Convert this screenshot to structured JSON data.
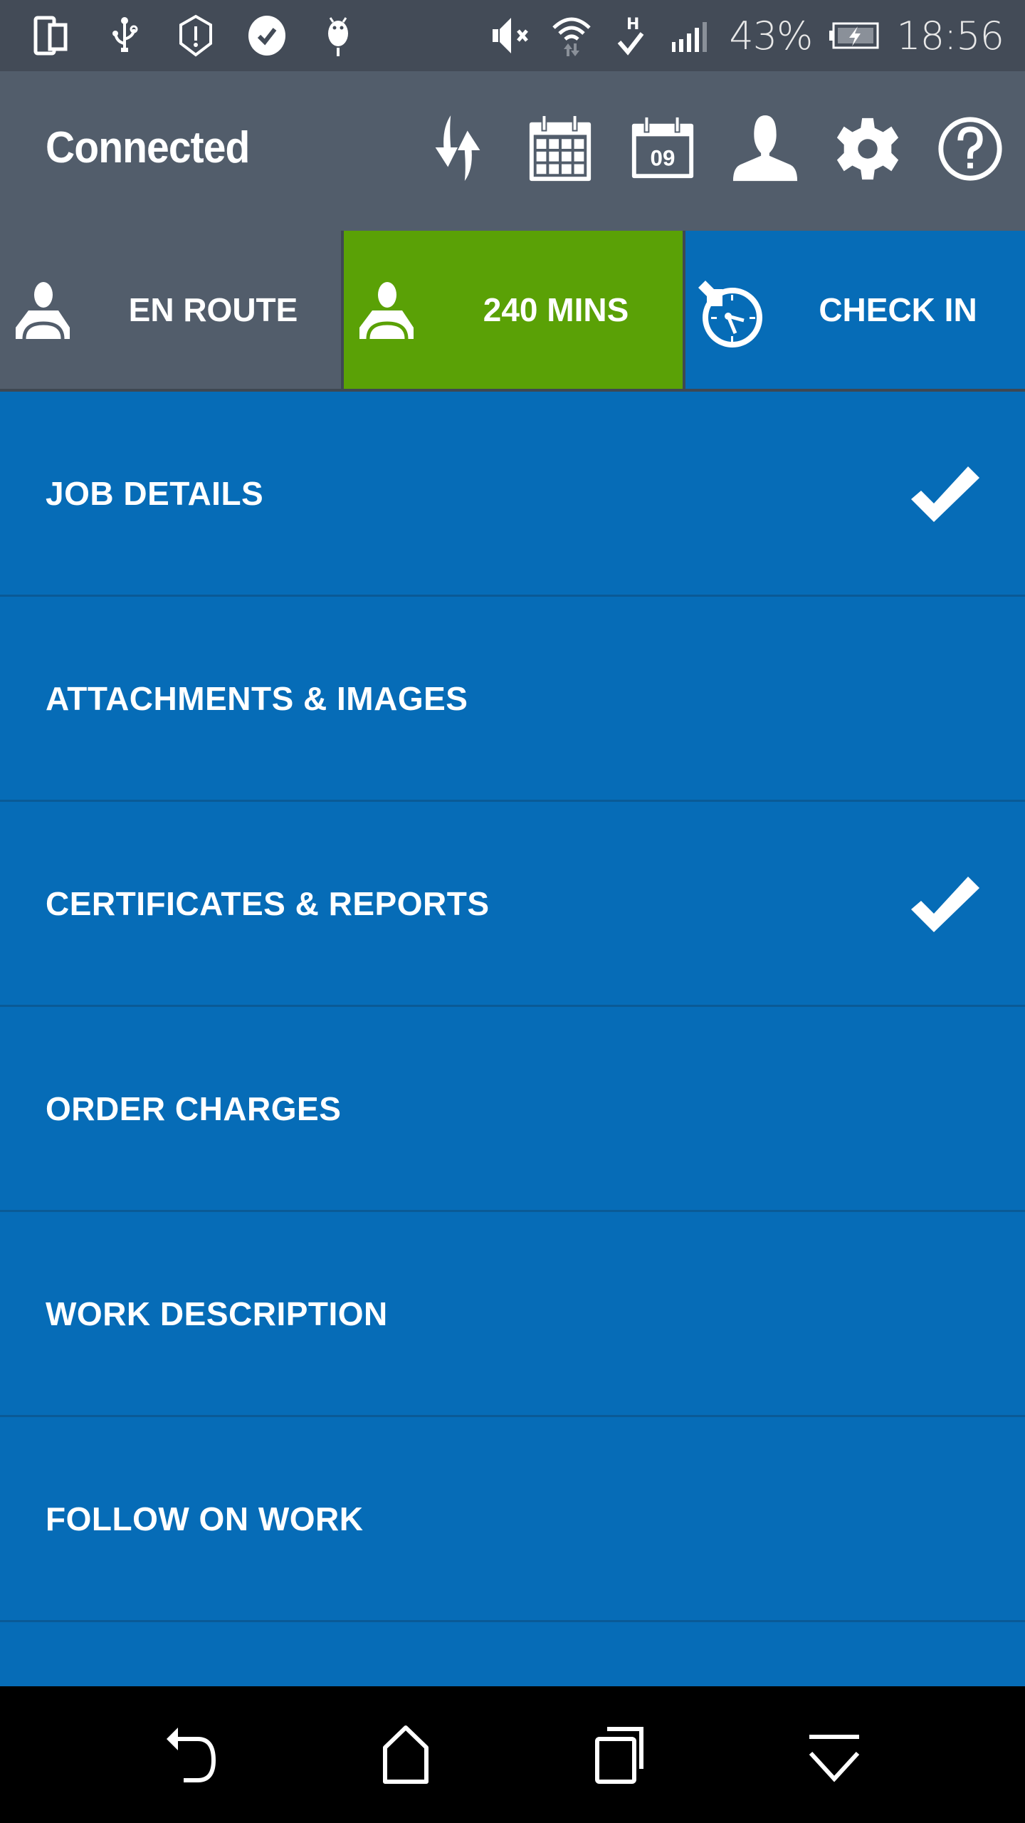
{
  "status_bar": {
    "left_icons": [
      "dual-screen-icon",
      "usb-icon",
      "shield-alert-icon",
      "skype-check-icon",
      "android-debug-icon"
    ],
    "right_icons": [
      "mute-icon",
      "wifi-icon",
      "hspa-signal-icon",
      "cell-signal-icon",
      "battery-charging-icon"
    ],
    "battery_percent": "43%",
    "time": "18:56"
  },
  "header": {
    "title": "Connected",
    "actions": [
      {
        "name": "sync",
        "icon": "sync-icon"
      },
      {
        "name": "calendar",
        "icon": "calendar-icon"
      },
      {
        "name": "today",
        "icon": "calendar-day-icon",
        "day": "09"
      },
      {
        "name": "profile",
        "icon": "user-icon"
      },
      {
        "name": "settings",
        "icon": "gear-icon"
      },
      {
        "name": "help",
        "icon": "help-icon"
      }
    ]
  },
  "action_row": {
    "en_route": {
      "label": "EN ROUTE",
      "icon": "driver-icon"
    },
    "mins": {
      "label": "240 MINS",
      "icon": "driver-icon",
      "color": "#5aa106"
    },
    "check_in": {
      "label": "CHECK IN",
      "icon": "stopwatch-icon",
      "color": "#066cb7"
    }
  },
  "menu": {
    "items": [
      {
        "label": "JOB DETAILS",
        "completed": true
      },
      {
        "label": "ATTACHMENTS & IMAGES",
        "completed": false
      },
      {
        "label": "CERTIFICATES & REPORTS",
        "completed": true
      },
      {
        "label": "ORDER CHARGES",
        "completed": false
      },
      {
        "label": "WORK DESCRIPTION",
        "completed": false
      },
      {
        "label": "FOLLOW ON WORK",
        "completed": false
      }
    ]
  },
  "nav_bar": {
    "buttons": [
      "back-icon",
      "home-icon",
      "recents-icon",
      "hide-keyboard-icon"
    ]
  },
  "colors": {
    "status_bar_bg": "#434b57",
    "header_bg": "#525d6b",
    "accent_green": "#5aa106",
    "accent_blue": "#066cb7"
  }
}
